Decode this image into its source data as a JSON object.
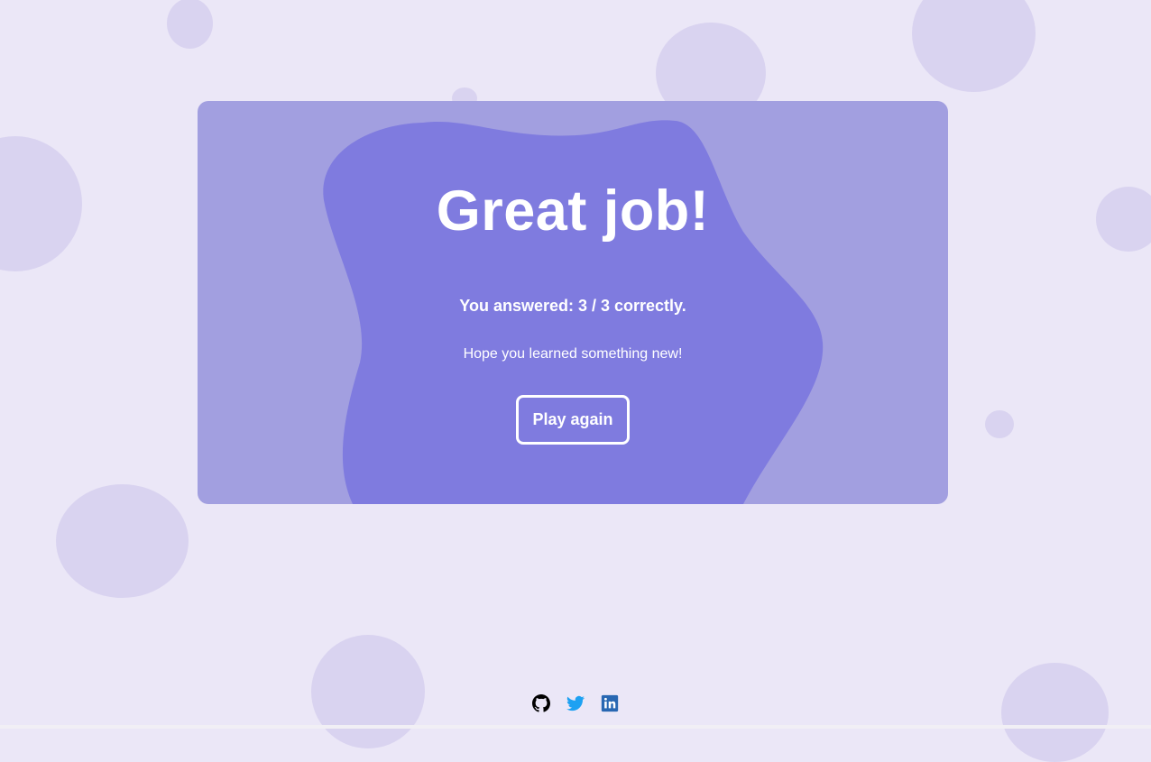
{
  "result": {
    "headline": "Great job!",
    "score_text": "You answered: 3 / 3 correctly.",
    "message": "Hope you learned something new!",
    "play_again_label": "Play again"
  },
  "footer": {
    "links": [
      {
        "name": "github",
        "icon": "github-icon",
        "color": "#000000"
      },
      {
        "name": "twitter",
        "icon": "twitter-icon",
        "color": "#1da1f2"
      },
      {
        "name": "linkedin",
        "icon": "linkedin-icon",
        "color": "#2867b2"
      }
    ]
  },
  "colors": {
    "page_background": "#ebe7f7",
    "bubble": "#d9d3f0",
    "card": "#a29fe0",
    "blob": "#7f7bdf",
    "text": "#ffffff"
  }
}
